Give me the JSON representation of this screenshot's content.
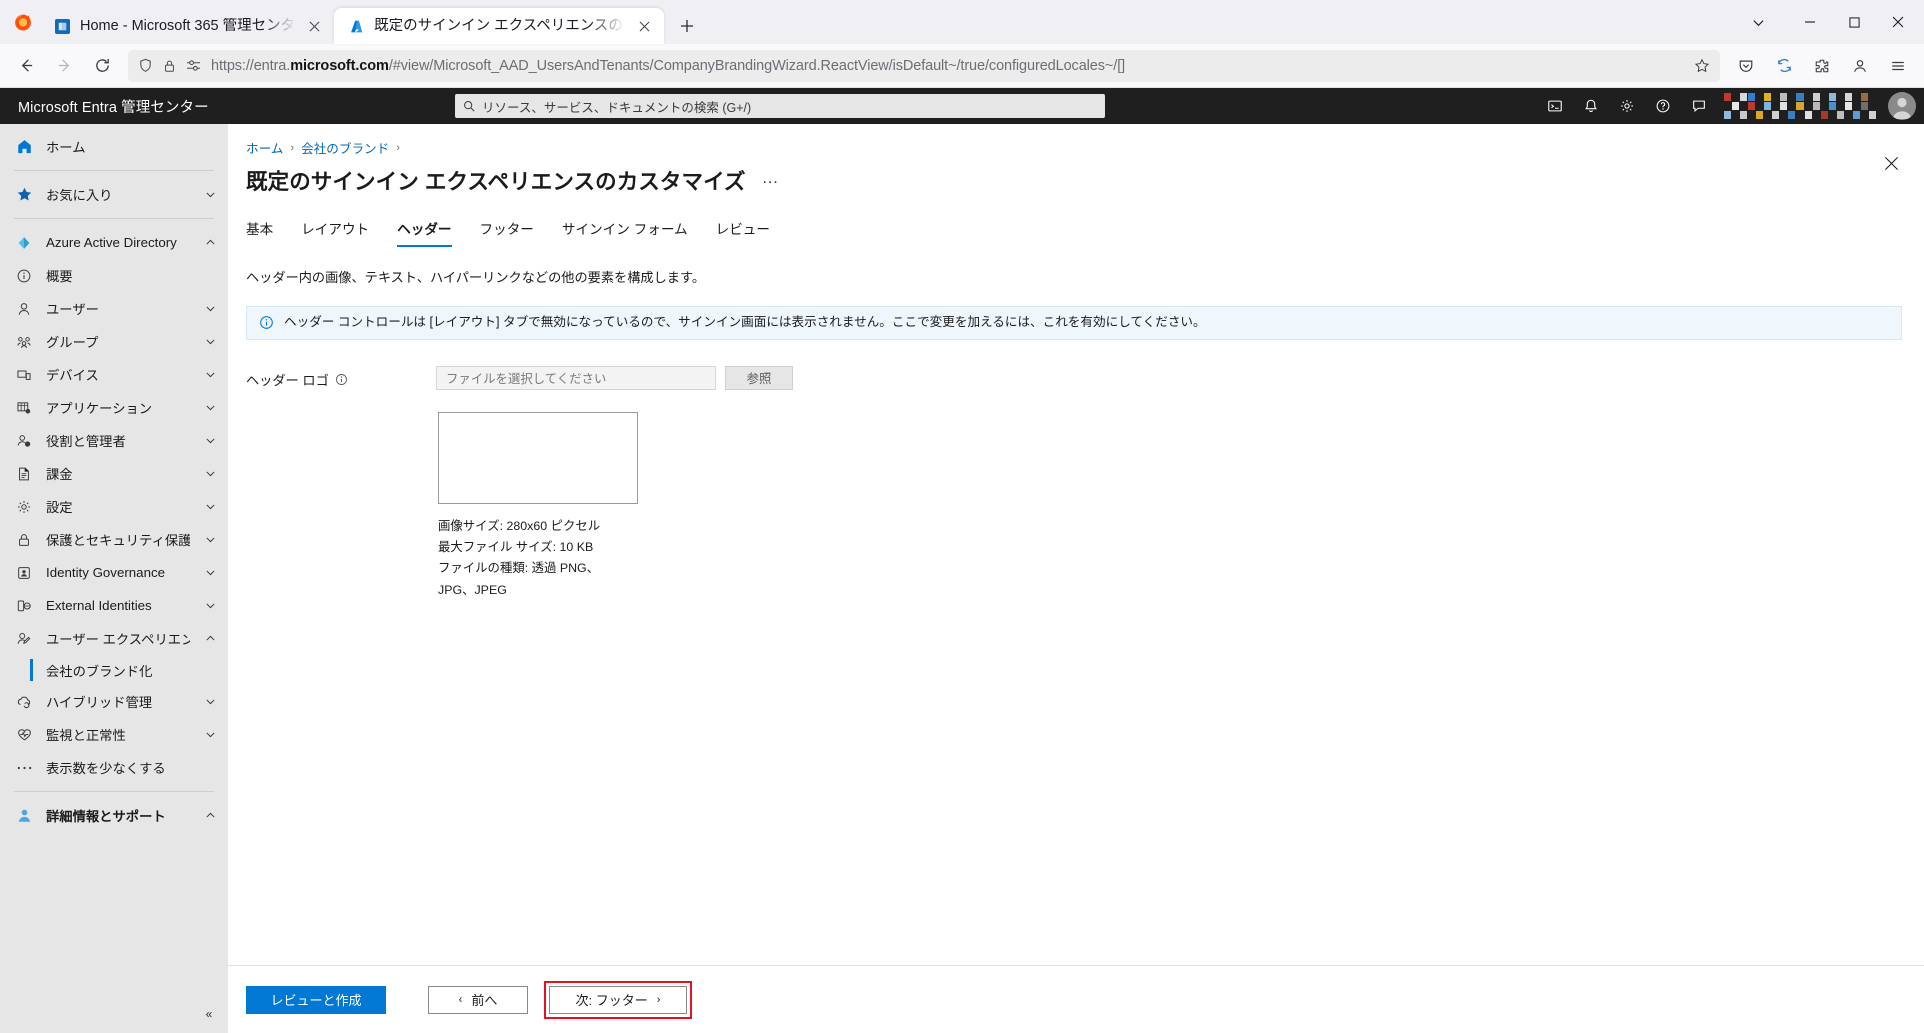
{
  "browser": {
    "tabs": [
      {
        "title": "Home - Microsoft 365 管理センタ",
        "favicon": "microsoft365-icon",
        "active": false
      },
      {
        "title": "既定のサインイン エクスペリエンスの力",
        "favicon": "azure-icon",
        "active": true
      }
    ],
    "new_tab_label": "+",
    "window_controls": {
      "list_all_tabs": "chevron-down-icon",
      "minimize": "minimize-icon",
      "maximize": "maximize-icon",
      "close": "close-icon"
    },
    "toolbar": {
      "back": "back-arrow-icon",
      "forward": "forward-arrow-icon",
      "reload": "reload-icon",
      "shield": "shield-icon",
      "lock": "lock-icon",
      "permissions": "permissions-icon",
      "url_prefix": "https://entra.",
      "url_bold": "microsoft.com",
      "url_suffix": "/#view/Microsoft_AAD_UsersAndTenants/CompanyBrandingWizard.ReactView/isDefault~/true/configuredLocales~/[]",
      "bookmark": "star-icon",
      "save_to_pocket": "pocket-icon",
      "sync": "sync-icon",
      "extensions": "extensions-icon",
      "account": "account-icon",
      "menu": "hamburger-menu-icon"
    }
  },
  "entra_header": {
    "brand": "Microsoft Entra 管理センター",
    "search_placeholder": "リソース、サービス、ドキュメントの検索 (G+/)",
    "icons": [
      "cloud-shell-icon",
      "notifications-icon",
      "settings-gear-icon",
      "help-question-icon",
      "feedback-icon"
    ],
    "avatar": "user-avatar"
  },
  "sidebar": {
    "items": [
      {
        "label": "ホーム",
        "icon": "home-icon",
        "chevron": false,
        "bold": false
      },
      {
        "label": "お気に入り",
        "icon": "star-icon",
        "chevron": true,
        "bold": false
      },
      {
        "label": "Azure Active Directory",
        "icon": "azure-ad-icon",
        "chevron": true,
        "bold": false
      },
      {
        "label": "概要",
        "icon": "info-circle-icon",
        "chevron": false,
        "bold": false
      },
      {
        "label": "ユーザー",
        "icon": "user-icon",
        "chevron": true,
        "bold": false
      },
      {
        "label": "グループ",
        "icon": "group-icon",
        "chevron": true,
        "bold": false
      },
      {
        "label": "デバイス",
        "icon": "device-icon",
        "chevron": true,
        "bold": false
      },
      {
        "label": "アプリケーション",
        "icon": "applications-icon",
        "chevron": true,
        "bold": false
      },
      {
        "label": "役割と管理者",
        "icon": "roles-admin-icon",
        "chevron": true,
        "bold": false
      },
      {
        "label": "課金",
        "icon": "billing-icon",
        "chevron": true,
        "bold": false
      },
      {
        "label": "設定",
        "icon": "settings-gear-icon",
        "chevron": true,
        "bold": false
      },
      {
        "label": "保護とセキュリティ保護",
        "icon": "lock-icon",
        "chevron": true,
        "bold": false
      },
      {
        "label": "Identity Governance",
        "icon": "governance-icon",
        "chevron": true,
        "bold": false
      },
      {
        "label": "External Identities",
        "icon": "external-identities-icon",
        "chevron": true,
        "bold": false
      },
      {
        "label": "ユーザー エクスペリエンス",
        "icon": "user-experience-icon",
        "chevron": true,
        "bold": false
      }
    ],
    "sub_item": {
      "label": "会社のブランド化",
      "selected": true
    },
    "items_after": [
      {
        "label": "ハイブリッド管理",
        "icon": "hybrid-cloud-icon",
        "chevron": true,
        "bold": false
      },
      {
        "label": "監視と正常性",
        "icon": "monitoring-health-icon",
        "chevron": true,
        "bold": false
      },
      {
        "label": "表示数を少なくする",
        "icon": "ellipsis-icon",
        "chevron": false,
        "bold": false
      }
    ],
    "footer_item": {
      "label": "詳細情報とサポート",
      "icon": "support-person-icon",
      "chevron": true,
      "bold": true
    },
    "collapse_label": "«"
  },
  "main": {
    "breadcrumb": [
      {
        "label": "ホーム",
        "link": true
      },
      {
        "label": "会社のブランド",
        "link": true
      }
    ],
    "breadcrumb_separator": "›",
    "title": "既定のサインイン エクスペリエンスのカスタマイズ",
    "title_more": "…",
    "close_label": "✕",
    "tabs": [
      {
        "label": "基本",
        "active": false
      },
      {
        "label": "レイアウト",
        "active": false
      },
      {
        "label": "ヘッダー",
        "active": true
      },
      {
        "label": "フッター",
        "active": false
      },
      {
        "label": "サインイン フォーム",
        "active": false
      },
      {
        "label": "レビュー",
        "active": false
      }
    ],
    "description": "ヘッダー内の画像、テキスト、ハイパーリンクなどの他の要素を構成します。",
    "info_banner": {
      "icon": "info-circle-icon",
      "text": "ヘッダー コントロールは [レイアウト] タブで無効になっているので、サインイン画面には表示されません。ここで変更を加えるには、これを有効にしてください。"
    },
    "header_logo_field": {
      "label": "ヘッダー ロゴ",
      "info_icon": "info-circle-icon",
      "file_value": "",
      "file_placeholder": "ファイルを選択してください",
      "browse_label": "参照"
    },
    "preview": {
      "alt": "header-logo-preview",
      "meta_lines": [
        "画像サイズ: 280x60 ピクセル",
        "最大ファイル サイズ: 10 KB",
        "ファイルの種類: 透過 PNG、",
        "JPG、JPEG"
      ]
    },
    "footer_actions": {
      "review_create": "レビューと作成",
      "previous": "前へ",
      "previous_chevron": "‹",
      "next": "次: フッター",
      "next_chevron": "›"
    }
  },
  "colors": {
    "accent_blue": "#0078d4",
    "link_blue": "#0067b8",
    "banner_bg": "#eff6fc",
    "highlight_red": "#e81123",
    "header_black": "#1f1f1f",
    "sidebar_gray": "#e6e6e6"
  }
}
